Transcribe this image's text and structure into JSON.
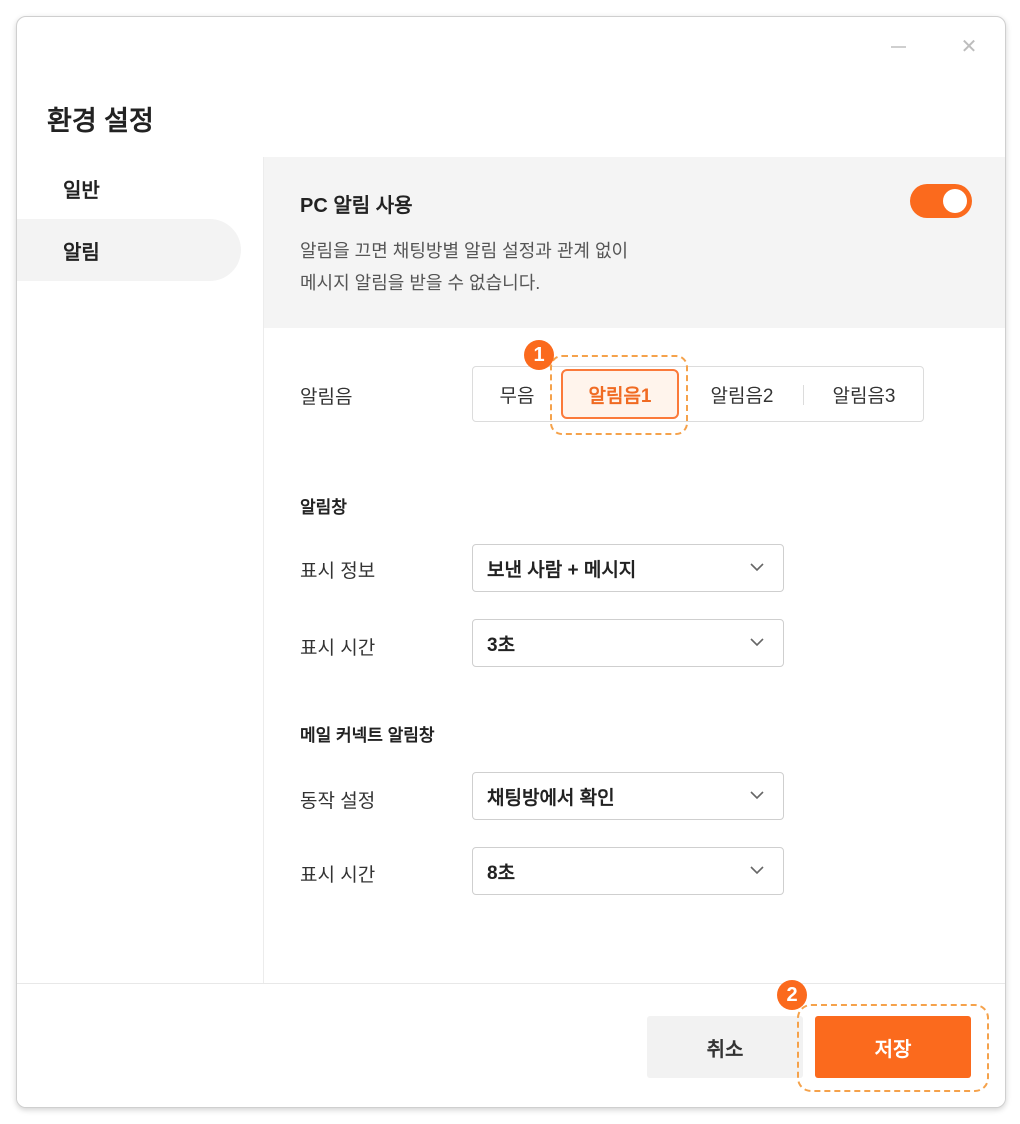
{
  "window": {
    "title": "환경 설정"
  },
  "sidebar": {
    "items": [
      {
        "label": "일반"
      },
      {
        "label": "알림"
      }
    ]
  },
  "pc_notify": {
    "title": "PC 알림 사용",
    "desc_line1": "알림을 끄면 채팅방별 알림 설정과 관계 없이",
    "desc_line2": "메시지 알림을 받을 수 없습니다.",
    "enabled": true
  },
  "sound": {
    "label": "알림음",
    "options": [
      "무음",
      "알림음1",
      "알림음2",
      "알림음3"
    ],
    "selected": "알림음1"
  },
  "popup": {
    "section_title": "알림창",
    "display_info_label": "표시 정보",
    "display_info_value": "보낸 사람 + 메시지",
    "display_time_label": "표시 시간",
    "display_time_value": "3초"
  },
  "mail_popup": {
    "section_title": "메일 커넥트 알림창",
    "action_label": "동작 설정",
    "action_value": "채팅방에서 확인",
    "display_time_label": "표시 시간",
    "display_time_value": "8초"
  },
  "footer": {
    "cancel_label": "취소",
    "save_label": "저장"
  },
  "markers": {
    "m1": "1",
    "m2": "2"
  },
  "colors": {
    "accent": "#fb6a1d",
    "highlight": "#f5a24b"
  }
}
